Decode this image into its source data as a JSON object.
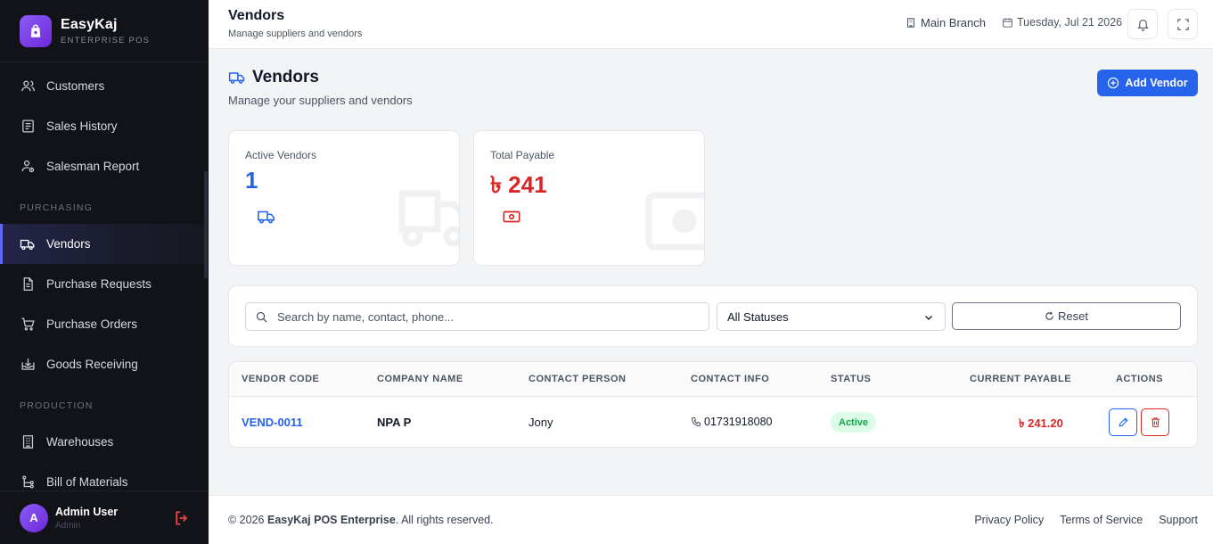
{
  "brand": {
    "name": "EasyKaj",
    "subtitle": "ENTERPRISE POS"
  },
  "sidebar": {
    "items": [
      {
        "label": "Customers"
      },
      {
        "label": "Sales History"
      },
      {
        "label": "Salesman Report"
      }
    ],
    "section_purchasing": "PURCHASING",
    "purchasing_items": [
      {
        "label": "Vendors",
        "active": true
      },
      {
        "label": "Purchase Requests"
      },
      {
        "label": "Purchase Orders"
      },
      {
        "label": "Goods Receiving"
      }
    ],
    "section_production": "PRODUCTION",
    "production_items": [
      {
        "label": "Warehouses"
      },
      {
        "label": "Bill of Materials"
      }
    ]
  },
  "user": {
    "initial": "A",
    "name": "Admin User",
    "role": "Admin"
  },
  "topbar": {
    "title": "Vendors",
    "subtitle": "Manage suppliers and vendors",
    "branch": "Main Branch",
    "date": "Tuesday, Jul 21 2026"
  },
  "page": {
    "title": "Vendors",
    "subtitle": "Manage your suppliers and vendors",
    "add_button": "Add Vendor"
  },
  "stats": {
    "active_vendors": {
      "label": "Active Vendors",
      "value": "1",
      "color": "#2563eb"
    },
    "total_payable": {
      "label": "Total Payable",
      "value": "৳ 241",
      "color": "#dc2626"
    }
  },
  "filters": {
    "search_placeholder": "Search by name, contact, phone...",
    "status_selected": "All Statuses",
    "reset_label": "Reset"
  },
  "table": {
    "columns": [
      "VENDOR CODE",
      "COMPANY NAME",
      "CONTACT PERSON",
      "CONTACT INFO",
      "STATUS",
      "CURRENT PAYABLE",
      "ACTIONS"
    ],
    "rows": [
      {
        "code": "VEND-0011",
        "company": "NPA P",
        "contact": "Jony",
        "phone": "01731918080",
        "status": "Active",
        "payable": "৳ 241.20"
      }
    ]
  },
  "footer": {
    "copyright_prefix": "© 2026",
    "company": "EasyKaj POS Enterprise",
    "copyright_suffix": ". All rights reserved.",
    "links": [
      "Privacy Policy",
      "Terms of Service",
      "Support"
    ]
  },
  "colors": {
    "accent": "#2563eb",
    "danger": "#dc2626",
    "success": "#16a34a",
    "brand": "#7c3aed"
  },
  "icons": [
    "bag-icon",
    "users-icon",
    "receipt-icon",
    "user-chart-icon",
    "truck-icon",
    "file-icon",
    "cart-icon",
    "inbox-download-icon",
    "building-icon",
    "hierarchy-icon",
    "logout-icon",
    "bell-icon",
    "fullscreen-icon",
    "calendar-icon",
    "search-icon",
    "chevron-down-icon",
    "refresh-icon",
    "plus-circle-icon",
    "cash-icon",
    "phone-icon",
    "edit-icon",
    "trash-icon"
  ]
}
